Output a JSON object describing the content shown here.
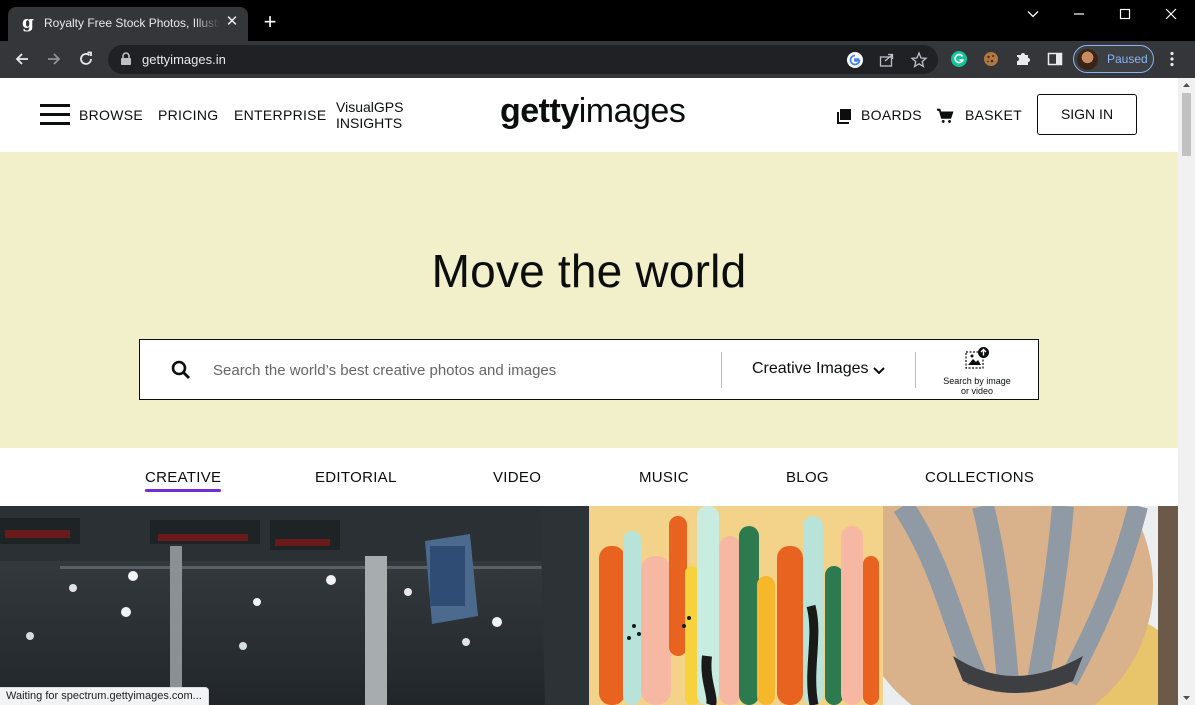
{
  "browser": {
    "tab_title": "Royalty Free Stock Photos, Illustrations",
    "tab_favicon": "g",
    "tab_close": "✕",
    "new_tab": "+",
    "url": "gettyimages.in",
    "profile_status": "Paused",
    "status_text": "Waiting for spectrum.gettyimages.com..."
  },
  "header": {
    "browse": "BROWSE",
    "pricing": "PRICING",
    "enterprise": "ENTERPRISE",
    "visualgps_line1": "VisualGPS",
    "visualgps_line2": "INSIGHTS",
    "logo_bold": "getty",
    "logo_light": "images",
    "boards": "BOARDS",
    "basket": "BASKET",
    "sign_in": "SIGN IN"
  },
  "hero": {
    "title": "Move the world",
    "search_placeholder": "Search the world’s best creative photos and images",
    "search_type": "Creative Images",
    "image_search_line1": "Search by image",
    "image_search_line2": "or video",
    "background_color": "#f2efcb"
  },
  "category_tabs": [
    {
      "label": "CREATIVE",
      "active": true
    },
    {
      "label": "EDITORIAL",
      "active": false
    },
    {
      "label": "VIDEO",
      "active": false
    },
    {
      "label": "MUSIC",
      "active": false
    },
    {
      "label": "BLOG",
      "active": false
    },
    {
      "label": "COLLECTIONS",
      "active": false
    }
  ],
  "icons": {
    "active_tab_underline": "#6f2ed6",
    "brand_text": "#0c0d0d"
  }
}
